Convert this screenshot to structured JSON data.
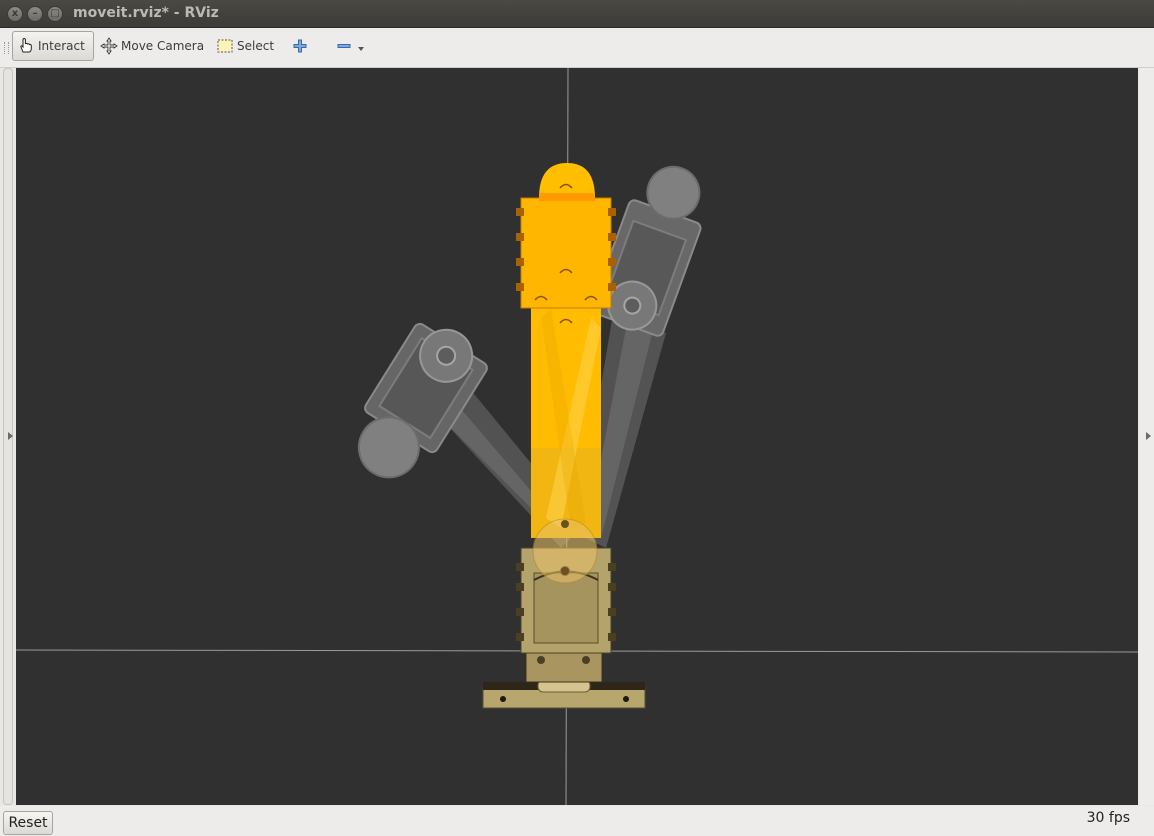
{
  "window": {
    "title": "moveit.rviz* - RViz",
    "close_glyph": "x",
    "minimize_glyph": "–",
    "maximize_glyph": "□"
  },
  "toolbar": {
    "tools": [
      {
        "label": "Interact",
        "icon": "hand-pointer-icon",
        "active": true
      },
      {
        "label": "Move Camera",
        "icon": "move-camera-icon",
        "active": false
      },
      {
        "label": "Select",
        "icon": "select-box-icon",
        "active": false
      }
    ],
    "add_tool_icon": "plus-icon",
    "remove_tool_icon": "minus-icon"
  },
  "viewport": {
    "background": "#303030",
    "robot_colors": {
      "planned_arm": "#ffbb00",
      "base": "#b7a56e",
      "ghost_trail": "#9a9a9a"
    }
  },
  "statusbar": {
    "reset_label": "Reset",
    "fps": "30 fps"
  }
}
